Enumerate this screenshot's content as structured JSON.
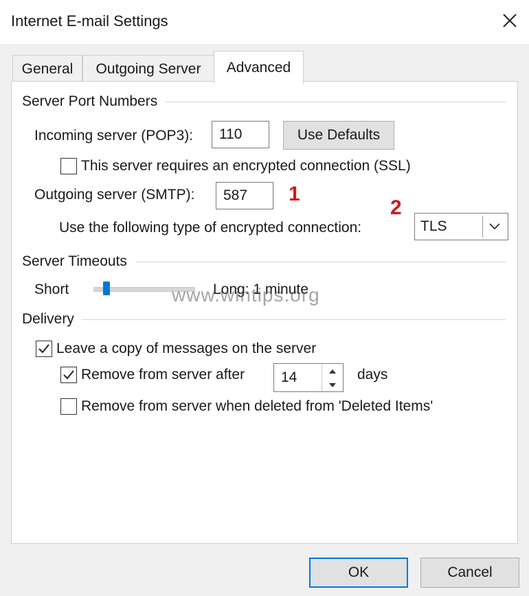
{
  "window": {
    "title": "Internet E-mail Settings"
  },
  "tabs": [
    {
      "label": "General"
    },
    {
      "label": "Outgoing Server"
    },
    {
      "label": "Advanced",
      "selected": true
    }
  ],
  "server_ports": {
    "group_label": "Server Port Numbers",
    "incoming_label": "Incoming server (POP3):",
    "incoming_value": "110",
    "use_defaults_label": "Use Defaults",
    "ssl_label": "This server requires an encrypted connection (SSL)",
    "ssl_checked": false,
    "outgoing_label": "Outgoing server (SMTP):",
    "outgoing_value": "587",
    "encryption_label": "Use the following type of encrypted connection:",
    "encryption_value": "TLS"
  },
  "timeouts": {
    "group_label": "Server Timeouts",
    "short_label": "Short",
    "long_label": "Long: 1 minute",
    "slider_fraction": 0.1
  },
  "delivery": {
    "group_label": "Delivery",
    "leave_copy_label": "Leave a copy of messages on the server",
    "leave_copy_checked": true,
    "remove_after_label": "Remove from server after",
    "remove_after_checked": true,
    "remove_after_value": "14",
    "days_label": "days",
    "remove_deleted_label": "Remove from server when deleted from 'Deleted Items'",
    "remove_deleted_checked": false
  },
  "annotations": {
    "one": "1",
    "two": "2"
  },
  "watermark": "www.wintips.org",
  "buttons": {
    "ok": "OK",
    "cancel": "Cancel"
  },
  "icons": {
    "close": "close-icon",
    "dropdown": "chevron-down-icon",
    "spin_up": "triangle-up-icon",
    "spin_down": "triangle-down-icon",
    "check": "checkmark-icon"
  },
  "colors": {
    "accent": "#0078d7",
    "annotation": "#d01919",
    "dialog_bg": "#f0f0f0"
  }
}
